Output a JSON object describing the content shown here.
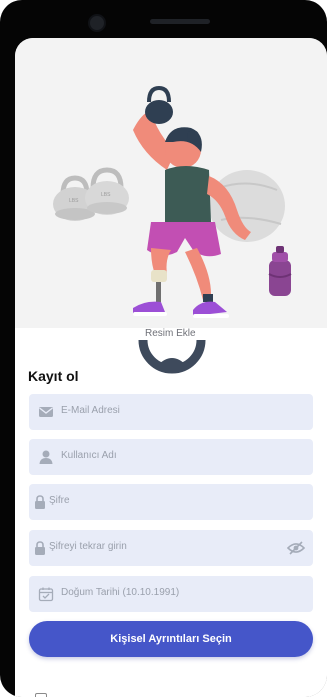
{
  "hero": {
    "illustration": "fitness-woman-kettlebell",
    "weight_label": "LBS"
  },
  "avatar": {
    "icon": "user-avatar-icon",
    "label": "Resim Ekle"
  },
  "form": {
    "title": "Kayıt ol",
    "email_placeholder": "E-Mail Adresi",
    "username_placeholder": "Kullanıcı Adı",
    "password_placeholder": "Şifre",
    "password_repeat_placeholder": "Şifreyi tekrar girin",
    "birthdate_placeholder": "Doğum Tarihi (10.10.1991)",
    "submit_label": "Kişisel Ayrıntıları Seçin"
  },
  "colors": {
    "accent": "#4556c9",
    "field_bg": "#e8ecf8",
    "placeholder": "#9aa0ac"
  }
}
